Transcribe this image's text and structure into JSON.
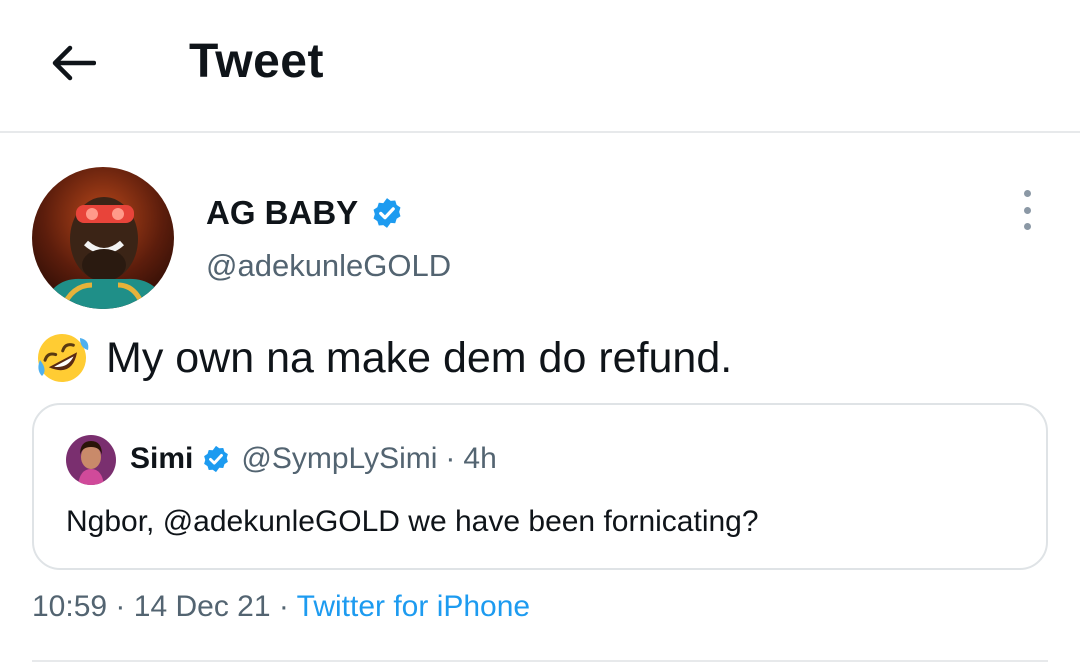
{
  "header": {
    "back_icon": "arrow-left-icon",
    "title": "Tweet"
  },
  "tweet": {
    "author": {
      "display_name": "AG BABY",
      "verified": true,
      "handle": "@adekunleGOLD"
    },
    "emoji": "rolling-on-floor-laughing",
    "text": "My own na make dem do refund.",
    "more_icon": "more-vertical-icon",
    "quoted": {
      "display_name": "Simi",
      "verified": true,
      "handle": "@SympLySimi",
      "separator": "·",
      "age": "4h",
      "text": "Ngbor, @adekunleGOLD we have been fornicating?"
    },
    "meta": {
      "time": "10:59",
      "sep1": "·",
      "date": "14 Dec 21",
      "sep2": "·",
      "source": "Twitter for iPhone"
    }
  },
  "colors": {
    "accent": "#1d9bf0",
    "secondary_text": "#536471",
    "divider": "#e7e9eb"
  }
}
